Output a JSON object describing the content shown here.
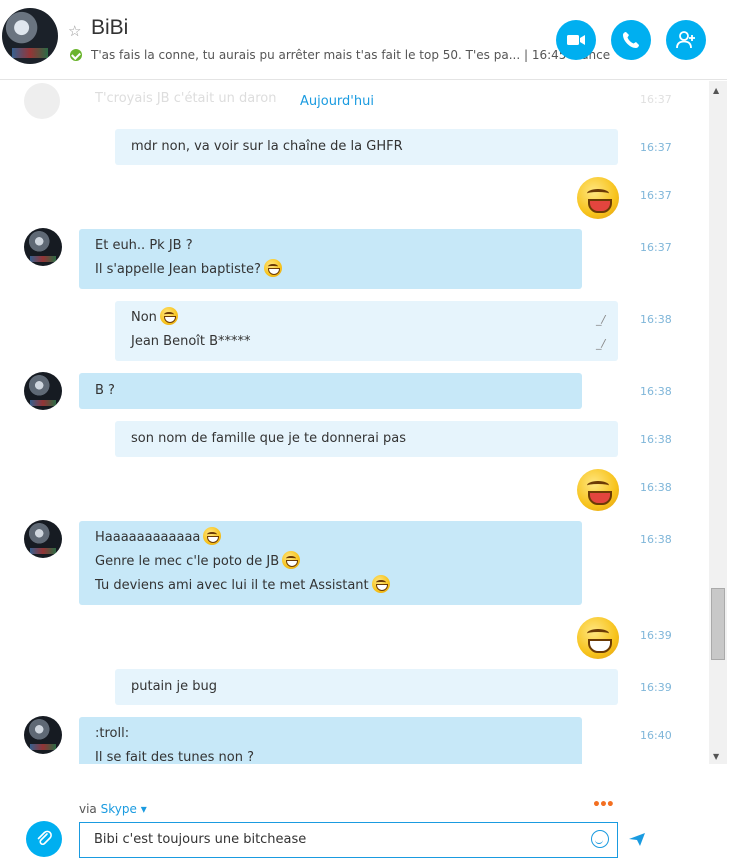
{
  "header": {
    "contact_name": "BiBi",
    "mood": "T'as fais la conne, tu aurais pu arrêter mais t'as fait le top 50. T'es pa... | 16:45 France",
    "video_call_icon": "video-camera-icon",
    "audio_call_icon": "phone-icon",
    "add_contact_icon": "add-person-icon"
  },
  "chat": {
    "date_separator": "Aujourd'hui",
    "ghost_text": "T'croyais JB c'était un daron",
    "ghost_time": "16:37",
    "messages": [
      {
        "line1": "mdr non, va voir sur la chaîne de la GHFR",
        "time": "16:37"
      },
      {
        "time": "16:37"
      },
      {
        "line1": "Et euh.. Pk JB ?",
        "line2": "Il s'appelle Jean baptiste?",
        "time": "16:37"
      },
      {
        "line1": "Non",
        "line2": "Jean Benoît B*****",
        "time": "16:38"
      },
      {
        "line1": "B ?",
        "time": "16:38"
      },
      {
        "line1": "son nom de famille que je te donnerai pas",
        "time": "16:38"
      },
      {
        "time": "16:38"
      },
      {
        "line1": "Haaaaaaaaaaaa",
        "line2": "Genre le mec c'le poto de JB",
        "line3": "Tu deviens ami avec lui il te met Assistant",
        "time": "16:38"
      },
      {
        "time": "16:39"
      },
      {
        "line1": "putain je bug",
        "time": "16:39"
      },
      {
        "line1": ":troll:",
        "line2": "Il se fait des tunes non ?",
        "time": "16:40"
      }
    ]
  },
  "composer": {
    "via_label": "via",
    "via_service": "Skype",
    "text": "Bibi c'est toujours une bitchease"
  }
}
